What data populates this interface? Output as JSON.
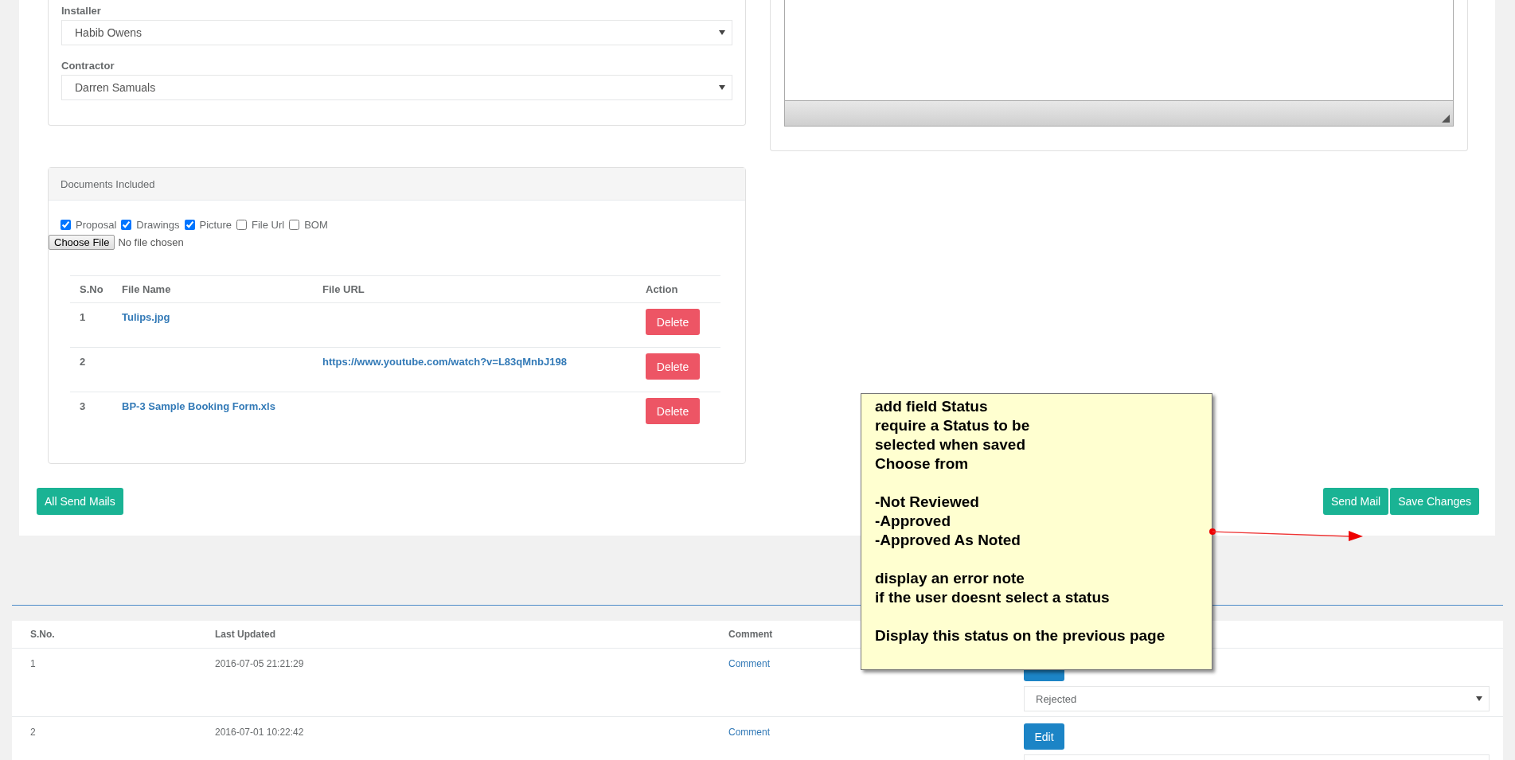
{
  "installer": {
    "label": "Installer",
    "value": "Habib Owens"
  },
  "contractor": {
    "label": "Contractor",
    "value": "Darren Samuals"
  },
  "documents": {
    "title": "Documents Included",
    "options": [
      {
        "label": "Proposal",
        "checked": true
      },
      {
        "label": "Drawings",
        "checked": true
      },
      {
        "label": "Picture",
        "checked": true
      },
      {
        "label": "File Url",
        "checked": false
      },
      {
        "label": "BOM",
        "checked": false
      }
    ],
    "file_button": "Choose File",
    "file_status": "No file chosen",
    "table": {
      "columns": [
        "S.No",
        "File Name",
        "File URL",
        "Action"
      ],
      "rows": [
        {
          "sno": "1",
          "file_name": "Tulips.jpg",
          "action": "Delete"
        },
        {
          "sno": "2",
          "file_url": "https://www.youtube.com/watch?v=L83qMnbJ198",
          "action": "Delete"
        },
        {
          "sno": "3",
          "file_name": "BP-3 Sample Booking Form.xls",
          "action": "Delete"
        }
      ]
    }
  },
  "left_buttons": [
    "All Send Mails"
  ],
  "right_buttons": [
    "Send Mail",
    "Save Changes"
  ],
  "history": {
    "columns": [
      "S.No.",
      "Last Updated",
      "Comment"
    ],
    "rows": [
      {
        "sno": "1",
        "updated": "2016-07-05 21:21:29",
        "comment": "Comment",
        "status": "Rejected"
      },
      {
        "sno": "2",
        "updated": "2016-07-01 10:22:42",
        "comment": "Comment",
        "edit": "Edit"
      }
    ]
  },
  "note": {
    "paragraphs": [
      "add field Status\nrequire a Status to be\nselected when saved\nChoose from",
      "-Not Reviewed\n-Approved\n-Approved As Noted",
      "display an error note\nif the user doesnt select a status",
      "Display this status on the previous page"
    ]
  }
}
